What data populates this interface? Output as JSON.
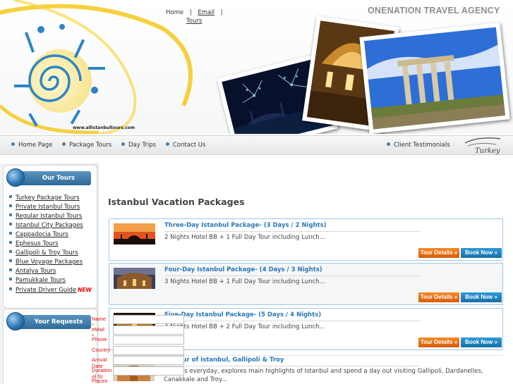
{
  "top_links": {
    "home": "Home",
    "sep1": "|",
    "email": "Email",
    "sep2": "|",
    "tours": "Tours"
  },
  "brand": {
    "agency_name": "ONENATION TRAVEL AGENCY",
    "site_url": "www.allistanbultours.com",
    "turkey_logo": "Turkey"
  },
  "nav": {
    "items": [
      "Home Page",
      "Package Tours",
      "Day Trips",
      "Contact Us"
    ],
    "right_item": "Client Testimonials"
  },
  "sidebar": {
    "tours_title": "Our Tours",
    "tours": [
      "Turkey Package Tours",
      "Private Istanbul Tours",
      "Regular Istanbul Tours",
      "Istanbul City Packages",
      "Cappadocia Tours",
      "Ephesus Tours",
      "Gallipoli & Troy Tours",
      "Blue Voyage Packages",
      "Antalya Tours",
      "Pamukkale Tours",
      "Private Driver Guide"
    ],
    "new_badge": "NEW",
    "requests_title": "Your Requests"
  },
  "form": {
    "fields": [
      "Name *",
      "eMail *",
      "Phone",
      "Country",
      "Arrival Date",
      "Duration of St",
      "Places of Interest"
    ]
  },
  "main": {
    "title": "Istanbul Vacation Packages",
    "button_details": "Tour Details »",
    "button_book": "Book Now »",
    "packages": [
      {
        "title": "Three-Day Istanbul Package- (3 Days / 2 Nights)",
        "desc": "2 Nights Hotel BB + 1 Full Day Tour including Lunch..."
      },
      {
        "title": "Four-Day Istanbul Package- (4 Days / 3 Nights)",
        "desc": "3 Nights Hotel BB + 1 Full Day Tour including Lunch..."
      },
      {
        "title": "Five-Day Istanbul Package- (5 Days / 4 Nights)",
        "desc": "4 Nights Hotel BB + 2 Full Day Tour including Lunch..."
      },
      {
        "title": "5 Day Tour of Istanbul, Gallipoli & Troy",
        "desc": "Departs everyday, explores main highlights of Istanbul and spend a day out visiting Gallipoli, Dardanelles, Canakkale and Troy..."
      }
    ]
  },
  "colors": {
    "accent_blue": "#2a78b8",
    "details_orange": "#e46d14",
    "book_blue": "#1f83c3",
    "required_red": "#dd1111"
  }
}
